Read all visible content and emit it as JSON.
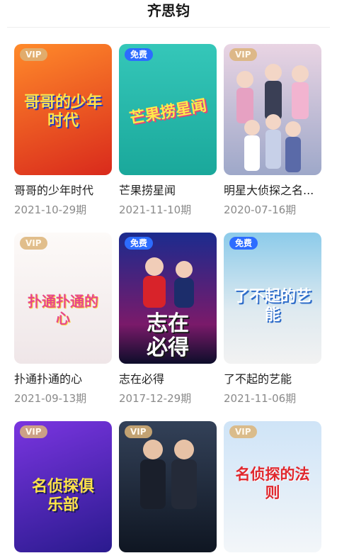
{
  "header": {
    "title": "齐思钧"
  },
  "items": [
    {
      "badge": "VIP",
      "name": "哥哥的少年时代",
      "date": "2021-10-29期",
      "poster_text": "哥哥的少年时代",
      "colors": [
        "#ff7a1a",
        "#d92a1c"
      ]
    },
    {
      "badge": "免费",
      "name": "芒果捞星闻",
      "date": "2021-11-10期",
      "poster_text": "芒果捞星闻",
      "colors": [
        "#2fc1b3",
        "#19a89c"
      ]
    },
    {
      "badge": "VIP",
      "name": "明星大侦探之名...",
      "date": "2020-07-16期",
      "poster_text": "",
      "colors": [
        "#d9c3d8",
        "#9fa6c8"
      ]
    },
    {
      "badge": "VIP",
      "name": "扑通扑通的心",
      "date": "2021-09-13期",
      "poster_text": "扑通扑通的心",
      "colors": [
        "#fbf7f5",
        "#f1e9ea"
      ]
    },
    {
      "badge": "免费",
      "name": "志在必得",
      "date": "2017-12-29期",
      "poster_text": "志在必得",
      "colors": [
        "#1e2b8c",
        "#8a1a6a"
      ]
    },
    {
      "badge": "免费",
      "name": "了不起的艺能",
      "date": "2021-11-06期",
      "poster_text": "了不起的艺能",
      "colors": [
        "#9fd4ef",
        "#e2eef3"
      ]
    },
    {
      "badge": "VIP",
      "name": "",
      "date": "",
      "poster_text": "名侦探俱乐部",
      "colors": [
        "#6b2bd6",
        "#2b1a8f"
      ]
    },
    {
      "badge": "VIP",
      "name": "",
      "date": "",
      "poster_text": "",
      "colors": [
        "#2a3548",
        "#121a28"
      ]
    },
    {
      "badge": "VIP",
      "name": "",
      "date": "",
      "poster_text": "名侦探的法则",
      "colors": [
        "#cfe4f7",
        "#f2f5f8"
      ]
    }
  ],
  "badge_colors": {
    "vip": "#dcb478",
    "free": "#2d6cff"
  }
}
